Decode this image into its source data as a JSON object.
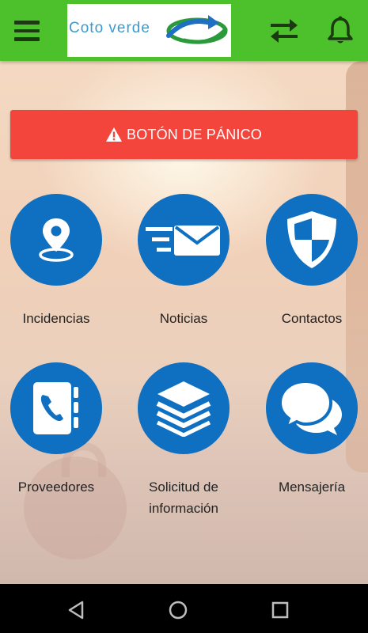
{
  "header": {
    "menu_icon": "hamburger-menu-icon",
    "logo_text": "Coto verde",
    "swap_icon": "swap-arrows-icon",
    "bell_icon": "bell-icon",
    "color": "#4cc12c"
  },
  "panic": {
    "label": "BOTÓN DE PÁNICO",
    "icon": "warning-icon",
    "color": "#f3453b"
  },
  "tiles": [
    {
      "label": "Incidencias",
      "icon": "location-pin-icon"
    },
    {
      "label": "Noticias",
      "icon": "fast-mail-icon"
    },
    {
      "label": "Contactos",
      "icon": "shield-icon"
    },
    {
      "label": "Proveedores",
      "icon": "phone-book-icon"
    },
    {
      "label": "Solicitud de información",
      "icon": "stacked-layers-icon"
    },
    {
      "label": "Mensajería",
      "icon": "chat-bubbles-icon"
    }
  ],
  "accent_color": "#0f6fc0",
  "navbar": {
    "back_icon": "back-triangle-icon",
    "home_icon": "home-circle-icon",
    "recents_icon": "recents-square-icon"
  }
}
